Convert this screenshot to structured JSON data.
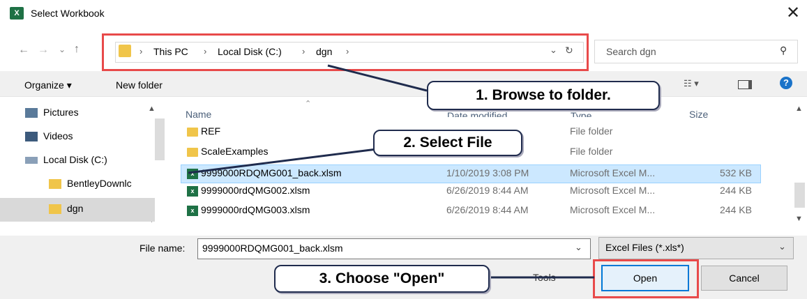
{
  "window": {
    "title": "Select Workbook",
    "app_icon": "X"
  },
  "nav": {
    "crumbs": [
      "This PC",
      "Local Disk (C:)",
      "dgn"
    ],
    "search_placeholder": "Search dgn"
  },
  "toolbar": {
    "organize_label": "Organize ▾",
    "new_folder_label": "New folder"
  },
  "sidebar": {
    "items": [
      {
        "label": "Pictures"
      },
      {
        "label": "Videos"
      },
      {
        "label": "Local Disk (C:)"
      },
      {
        "label": "BentleyDownlc"
      },
      {
        "label": "dgn"
      }
    ]
  },
  "columns": {
    "name": "Name",
    "date": "Date modified",
    "type": "Type",
    "size": "Size"
  },
  "files": [
    {
      "name": "REF",
      "date": "",
      "type": "File folder",
      "size": ""
    },
    {
      "name": "ScaleExamples",
      "date": "",
      "type": "File folder",
      "size": ""
    },
    {
      "name": "9999000RDQMG001_back.xlsm",
      "date": "1/10/2019 3:08 PM",
      "type": "Microsoft Excel M...",
      "size": "532 KB"
    },
    {
      "name": "9999000rdQMG002.xlsm",
      "date": "6/26/2019 8:44 AM",
      "type": "Microsoft Excel M...",
      "size": "244 KB"
    },
    {
      "name": "9999000rdQMG003.xlsm",
      "date": "6/26/2019 8:44 AM",
      "type": "Microsoft Excel M...",
      "size": "244 KB"
    }
  ],
  "footer": {
    "file_name_label": "File name:",
    "file_name_value": "9999000RDQMG001_back.xlsm",
    "filter_value": "Excel Files (*.xls*)",
    "tools_label": "Tools",
    "open_label": "Open",
    "cancel_label": "Cancel"
  },
  "callouts": {
    "step1": "1. Browse to folder.",
    "step2": "2. Select File",
    "step3": "3. Choose \"Open\""
  },
  "colors": {
    "highlight": "#e84a4a",
    "selected_row": "#cce8ff",
    "callout_border": "#1f2b4d"
  }
}
